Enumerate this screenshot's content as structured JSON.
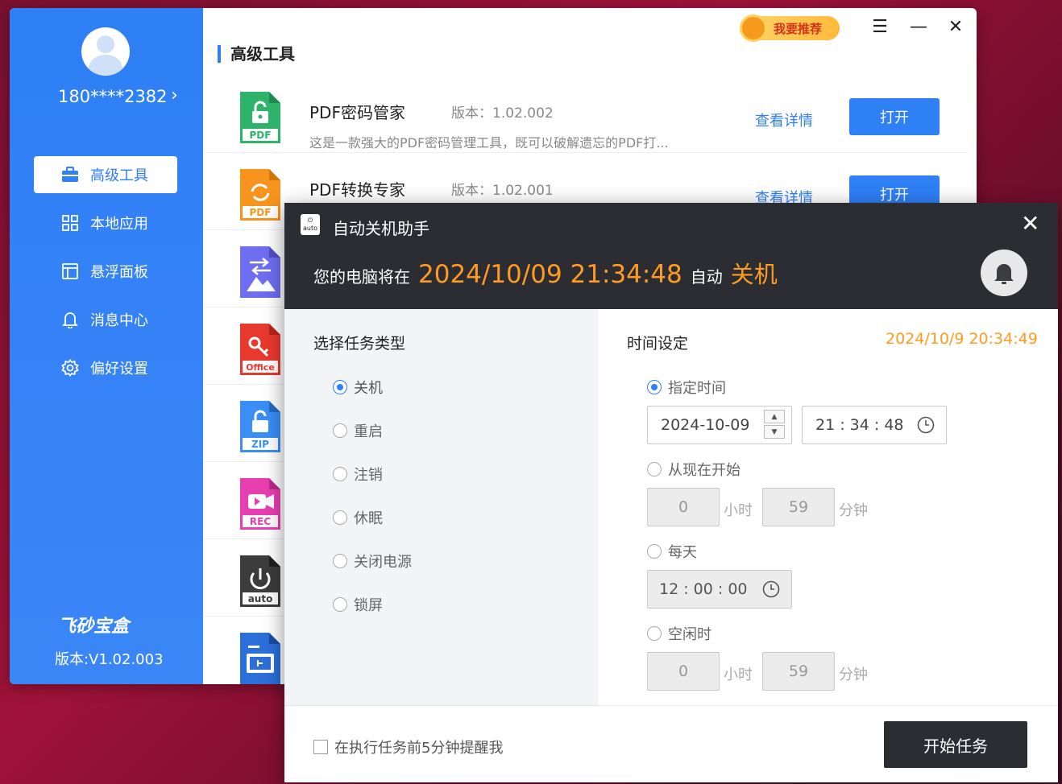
{
  "user": {
    "phone": "180****2382"
  },
  "sidebar": {
    "items": [
      {
        "label": "高级工具",
        "icon": "toolbox-icon",
        "active": true
      },
      {
        "label": "本地应用",
        "icon": "grid-icon"
      },
      {
        "label": "悬浮面板",
        "icon": "panel-icon"
      },
      {
        "label": "消息中心",
        "icon": "bell-icon"
      },
      {
        "label": "偏好设置",
        "icon": "gear-icon"
      }
    ],
    "brand": "飞砂宝盒",
    "version": "版本:V1.02.003"
  },
  "topbar": {
    "recommend": "我要推荐"
  },
  "section": {
    "title": "高级工具"
  },
  "apps": [
    {
      "name": "PDF密码管家",
      "version": "版本：1.02.002",
      "desc": "这是一款强大的PDF密码管理工具，既可以破解遗忘的PDF打...",
      "detail": "查看详情",
      "open": "打开",
      "icon_label": "PDF",
      "color": "#2db36a"
    },
    {
      "name": "PDF转换专家",
      "version": "版本：1.02.001",
      "desc": "",
      "detail": "查看详情",
      "open": "打开",
      "icon_label": "PDF",
      "color": "#f7941d"
    }
  ],
  "app_icons": [
    {
      "label": "",
      "color": "#6d6ef0"
    },
    {
      "label": "Office",
      "color": "#e8392e"
    },
    {
      "label": "ZIP",
      "color": "#3a8ef6"
    },
    {
      "label": "REC",
      "color": "#e83fb0"
    },
    {
      "label": "auto",
      "color": "#3c3c3c"
    },
    {
      "label": "",
      "color": "#2c6fd8"
    }
  ],
  "dialog": {
    "logo": "auto",
    "title": "自动关机助手",
    "msg_prefix": "您的电脑将在",
    "msg_time": "2024/10/09 21:34:48",
    "msg_mid": "自动",
    "msg_action": "关机",
    "left_title": "选择任务类型",
    "task_types": [
      {
        "label": "关机",
        "checked": true
      },
      {
        "label": "重启"
      },
      {
        "label": "注销"
      },
      {
        "label": "休眠"
      },
      {
        "label": "关闭电源"
      },
      {
        "label": "锁屏"
      }
    ],
    "right_title": "时间设定",
    "current_time": "2024/10/9 20:34:49",
    "opt_specified": "指定时间",
    "date_value": "2024-10-09",
    "time_value": "21 : 34 : 48",
    "opt_from_now": "从现在开始",
    "from_now_hours": "0",
    "from_now_minutes": "59",
    "unit_hour": "小时",
    "unit_minute": "分钟",
    "opt_daily": "每天",
    "daily_time": "12 : 00 : 00",
    "opt_idle": "空闲时",
    "idle_hours": "0",
    "idle_minutes": "59",
    "remind_label": "在执行任务前5分钟提醒我",
    "start_button": "开始任务"
  }
}
